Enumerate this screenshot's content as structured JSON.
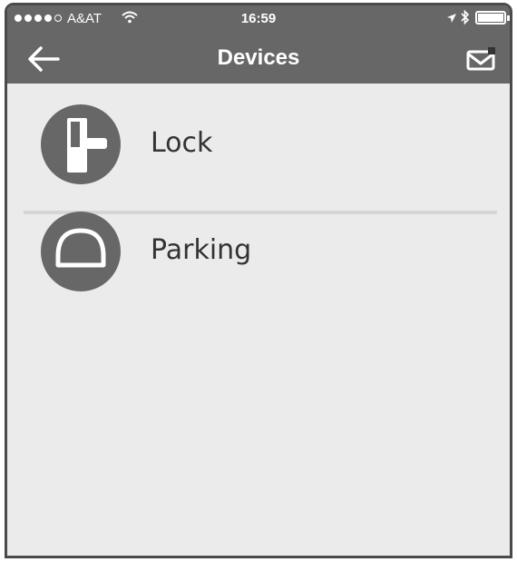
{
  "status_bar": {
    "carrier": "A&AT",
    "time": "16:59",
    "signal_bars": 4,
    "icons": [
      "signal-icon",
      "wifi-icon",
      "location-arrow-icon",
      "bluetooth-icon",
      "battery-icon"
    ]
  },
  "nav": {
    "title": "Devices",
    "back_icon": "back-arrow-icon",
    "mail_icon": "mail-icon"
  },
  "devices": [
    {
      "label": "Lock",
      "icon": "lock-icon"
    },
    {
      "label": "Parking",
      "icon": "parking-icon"
    }
  ],
  "colors": {
    "bar": "#676767",
    "background": "#ebebeb",
    "icon_circle": "#676767",
    "divider": "#d6d6d6",
    "text": "#333333"
  }
}
